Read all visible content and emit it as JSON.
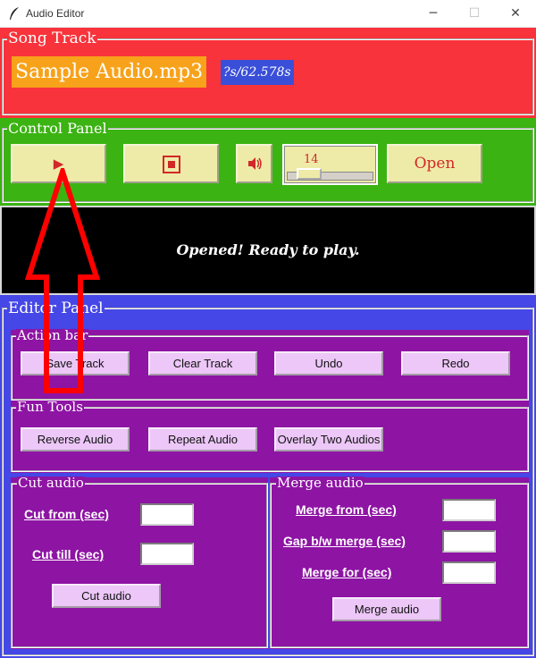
{
  "window": {
    "title": "Audio Editor",
    "minimize_glyph": "─",
    "maximize_glyph": "☐",
    "close_glyph": "✕",
    "app_icon": "feather-icon"
  },
  "song_track": {
    "frame_title": "Song Track",
    "file_name": "Sample Audio.mp3",
    "time": "?s/62.578s"
  },
  "control_panel": {
    "frame_title": "Control Panel",
    "play_glyph": "▶",
    "stop_icon": "stop-icon",
    "volume_icon": "speaker-icon",
    "volume_value": "14",
    "volume_level_fraction": 0.14,
    "open_label": "Open"
  },
  "status": {
    "message": "Opened! Ready to play."
  },
  "editor_panel": {
    "frame_title": "Editor Panel",
    "action_bar": {
      "title": "Action bar",
      "buttons": [
        "Save Track",
        "Clear Track",
        "Undo",
        "Redo"
      ]
    },
    "fun_tools": {
      "title": "Fun Tools",
      "buttons": [
        "Reverse Audio",
        "Repeat Audio",
        "Overlay Two Audios"
      ]
    },
    "cut_audio": {
      "title": "Cut audio",
      "from_label": "Cut from (sec)",
      "till_label": "Cut till (sec)",
      "from_value": "",
      "till_value": "",
      "button": "Cut audio"
    },
    "merge_audio": {
      "title": "Merge audio",
      "from_label": "Merge from (sec)",
      "gap_label": "Gap b/w merge (sec)",
      "for_label": "Merge for (sec)",
      "from_value": "",
      "gap_value": "",
      "for_value": "",
      "button": "Merge audio"
    }
  },
  "colors": {
    "song_track_bg": "#f8333b",
    "control_panel_bg": "#3bb312",
    "status_bg": "#000000",
    "editor_bg": "#4547e6",
    "subframe_bg": "#8e14a4",
    "annotation_arrow": "#ff0000"
  }
}
